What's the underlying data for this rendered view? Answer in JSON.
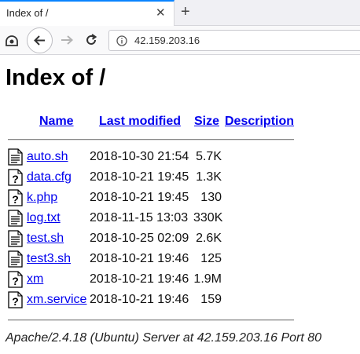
{
  "browser": {
    "tab_title": "Index of /",
    "tab_close": "✕",
    "new_tab": "+",
    "url": "42.159.203.16"
  },
  "page": {
    "heading": "Index of /",
    "columns": {
      "name": "Name",
      "last_modified": "Last modified",
      "size": "Size",
      "description": "Description"
    },
    "files": [
      {
        "icon": "text-file-icon",
        "name": "auto.sh",
        "modified": "2018-10-30 21:54",
        "size": "5.7K"
      },
      {
        "icon": "unknown-file-icon",
        "name": "data.cfg",
        "modified": "2018-10-21 19:45",
        "size": "1.3K"
      },
      {
        "icon": "unknown-file-icon",
        "name": "k.php",
        "modified": "2018-10-21 19:45",
        "size": "130"
      },
      {
        "icon": "text-file-icon",
        "name": "log.txt",
        "modified": "2018-11-15 13:03",
        "size": "330K"
      },
      {
        "icon": "text-file-icon",
        "name": "test.sh",
        "modified": "2018-10-25 02:09",
        "size": "2.6K"
      },
      {
        "icon": "text-file-icon",
        "name": "test3.sh",
        "modified": "2018-10-21 19:46",
        "size": "125"
      },
      {
        "icon": "unknown-file-icon",
        "name": "xm",
        "modified": "2018-10-21 19:46",
        "size": "1.9M"
      },
      {
        "icon": "unknown-file-icon",
        "name": "xm.service",
        "modified": "2018-10-21 19:46",
        "size": "159"
      }
    ],
    "footer": "Apache/2.4.18 (Ubuntu) Server at 42.159.203.16 Port 80"
  }
}
